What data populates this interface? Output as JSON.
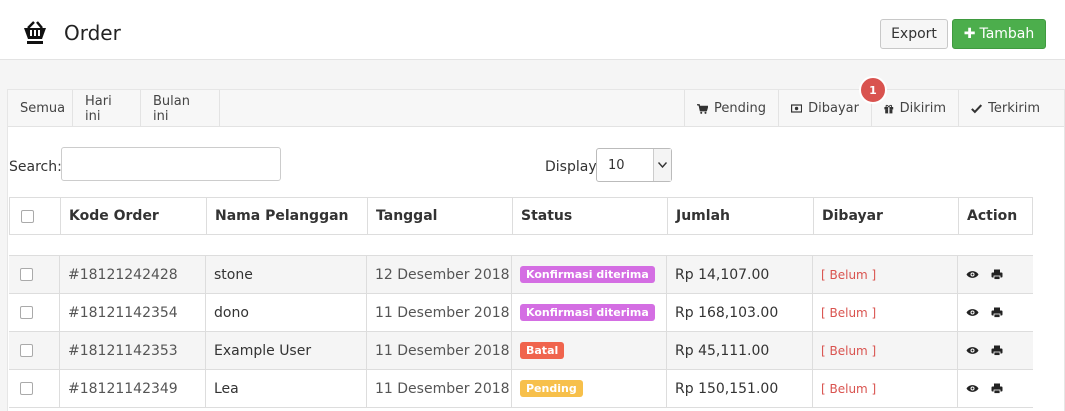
{
  "header": {
    "title": "Order",
    "export_label": "Export",
    "add_label": "Tambah"
  },
  "filters": {
    "left": [
      "Semua",
      "Hari ini",
      "Bulan ini"
    ],
    "right": [
      {
        "label": "Pending",
        "icon": "cart-icon"
      },
      {
        "label": "Dibayar",
        "icon": "money-icon"
      },
      {
        "label": "Dikirim",
        "icon": "gift-icon"
      },
      {
        "label": "Terkirim",
        "icon": "check-icon"
      }
    ],
    "badge_count": "1"
  },
  "search": {
    "label": "Search:",
    "value": ""
  },
  "display": {
    "label": "Display",
    "value": "10"
  },
  "table": {
    "columns": [
      "Kode Order",
      "Nama Pelanggan",
      "Tanggal",
      "Status",
      "Jumlah",
      "Dibayar",
      "Action"
    ],
    "rows": [
      {
        "kode": "#18121242428",
        "nama": "stone",
        "tanggal": "12 Desember 2018",
        "status": "Konfirmasi diterima",
        "status_color": "#d46ee3",
        "jumlah": "Rp 14,107.00",
        "dibayar": "[ Belum ]"
      },
      {
        "kode": "#18121142354",
        "nama": "dono",
        "tanggal": "11 Desember 2018",
        "status": "Konfirmasi diterima",
        "status_color": "#d46ee3",
        "jumlah": "Rp 168,103.00",
        "dibayar": "[ Belum ]"
      },
      {
        "kode": "#18121142353",
        "nama": "Example User",
        "tanggal": "11 Desember 2018",
        "status": "Batal",
        "status_color": "#f0644d",
        "jumlah": "Rp 45,111.00",
        "dibayar": "[ Belum ]"
      },
      {
        "kode": "#18121142349",
        "nama": "Lea",
        "tanggal": "11 Desember 2018",
        "status": "Pending",
        "status_color": "#f7c04b",
        "jumlah": "Rp 150,151.00",
        "dibayar": "[ Belum ]"
      }
    ]
  },
  "colors": {
    "accent_green": "#4cae4c",
    "badge_red": "#d9534f",
    "belum_red": "#d9534f"
  }
}
